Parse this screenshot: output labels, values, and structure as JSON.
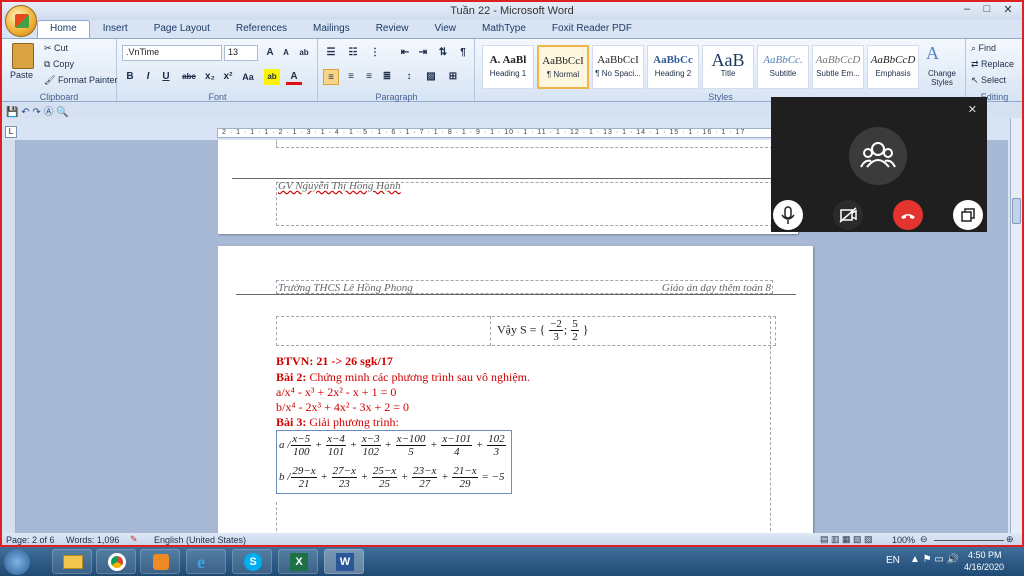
{
  "window": {
    "title": "Tuần 22 - Microsoft Word",
    "minimize": "–",
    "maximize": "□",
    "close": "✕"
  },
  "tabs": [
    "Home",
    "Insert",
    "Page Layout",
    "References",
    "Mailings",
    "Review",
    "View",
    "MathType",
    "Foxit Reader PDF"
  ],
  "clipboard": {
    "paste": "Paste",
    "cut": "Cut",
    "copy": "Copy",
    "format_painter": "Format Painter",
    "label": "Clipboard"
  },
  "font": {
    "family": ".VnTime",
    "size": "13",
    "label": "Font",
    "buttons": [
      "B",
      "I",
      "U",
      "abc",
      "x₂",
      "x²",
      "Aa"
    ]
  },
  "paragraph": {
    "label": "Paragraph"
  },
  "styles": {
    "label": "Styles",
    "items": [
      {
        "preview": "A. AaBl",
        "name": "Heading 1"
      },
      {
        "preview": "AaBbCcI",
        "name": "¶ Normal"
      },
      {
        "preview": "AaBbCcI",
        "name": "¶ No Spaci..."
      },
      {
        "preview": "AaBbCc",
        "name": "Heading 2"
      },
      {
        "preview": "AaB",
        "name": "Title"
      },
      {
        "preview": "AaBbCc.",
        "name": "Subtitle"
      },
      {
        "preview": "AaBbCcD",
        "name": "Subtle Em..."
      },
      {
        "preview": "AaBbCcD",
        "name": "Emphasis"
      }
    ],
    "change": "Change Styles"
  },
  "editing": {
    "find": "Find",
    "replace": "Replace",
    "select": "Select",
    "label": "Editing"
  },
  "ruler_marks": "2 · 1 · 1 · 1 · 2 · 1 · 3 · 1 · 4 · 1 · 5 · 1 · 6 · 1 · 7 · 1 · 8 · 1 · 9 · 1 · 10 · 1 · 11 · 1 · 12 · 1 · 13 · 1 · 14 · 1 · 15 · 1 · 16 · 1 · 17",
  "page1": {
    "footer": "GV Nguyễn Thị Hồng Hạnh"
  },
  "page2": {
    "header_left": "Trường THCS Lê Hồng Phong",
    "header_right": "Giáo án dạy thêm toán 8",
    "answer_prefix": "Vậy S = {",
    "answer_suffix": "}",
    "ans_f1_num": "−2",
    "ans_f1_den": "3",
    "ans_sep": ";",
    "ans_f2_num": "5",
    "ans_f2_den": "2",
    "btvn": "BTVN: 21 -> 26 sgk/17",
    "bai2_title": "Bài 2:",
    "bai2_text": "Chứng minh các phương trình sau vô nghiệm.",
    "bai2_a": "a/x⁴ - x³ + 2x² - x + 1 = 0",
    "bai2_b": "b/x⁴ - 2x³ + 4x² - 3x + 2 = 0",
    "bai3_title": "Bài 3:",
    "bai3_text": "Giải phương trình:",
    "eq_a_label": "a /",
    "eq_a": [
      [
        "x−5",
        "100"
      ],
      [
        "x−4",
        "101"
      ],
      [
        "x−3",
        "102"
      ],
      [
        "x−100",
        "5"
      ],
      [
        "x−101",
        "4"
      ],
      [
        "102",
        "3"
      ]
    ],
    "eq_b_label": "b /",
    "eq_b": [
      [
        "29−x",
        "21"
      ],
      [
        "27−x",
        "23"
      ],
      [
        "25−x",
        "25"
      ],
      [
        "23−x",
        "27"
      ],
      [
        "21−x",
        "29"
      ]
    ],
    "eq_b_result": "= −5"
  },
  "status": {
    "page": "Page: 2 of 6",
    "words": "Words: 1,096",
    "language": "English (United States)",
    "zoom": "100%"
  },
  "taskbar": {
    "lang": "EN",
    "time": "4:50 PM",
    "date": "4/16/2020"
  }
}
